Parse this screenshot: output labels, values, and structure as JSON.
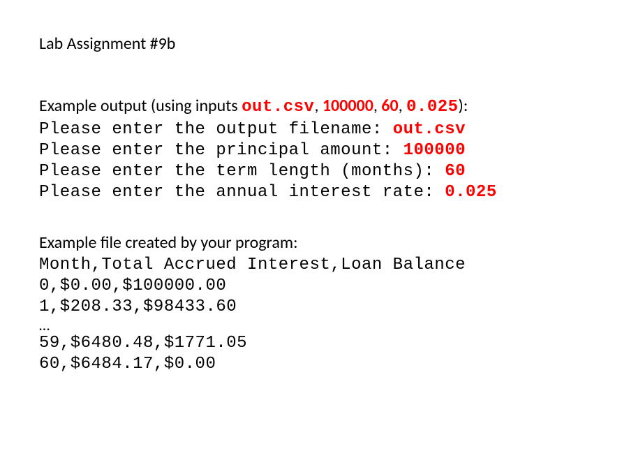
{
  "title": "Lab Assignment #9b",
  "example_output": {
    "heading_prefix": "Example output (using inputs ",
    "heading_suffix": "):",
    "inputs_display": [
      {
        "text": "out.csv",
        "mono": true
      },
      {
        "text": "100000",
        "mono": false
      },
      {
        "text": "60",
        "mono": false
      },
      {
        "text": "0.025",
        "mono": false
      }
    ],
    "prompts": [
      {
        "label": "Please enter the output filename: ",
        "value": "out.csv"
      },
      {
        "label": "Please enter the principal amount: ",
        "value": "100000"
      },
      {
        "label": "Please enter the term length (months): ",
        "value": "60"
      },
      {
        "label": "Please enter the annual interest rate: ",
        "value": "0.025"
      }
    ]
  },
  "example_file": {
    "heading": "Example file created by your program:",
    "header_line": "Month,Total Accrued Interest,Loan Balance",
    "rows_before": [
      "0,$0.00,$100000.00",
      "1,$208.33,$98433.60"
    ],
    "ellipsis": "…",
    "rows_after": [
      "59,$6480.48,$1771.05",
      "60,$6484.17,$0.00"
    ]
  }
}
